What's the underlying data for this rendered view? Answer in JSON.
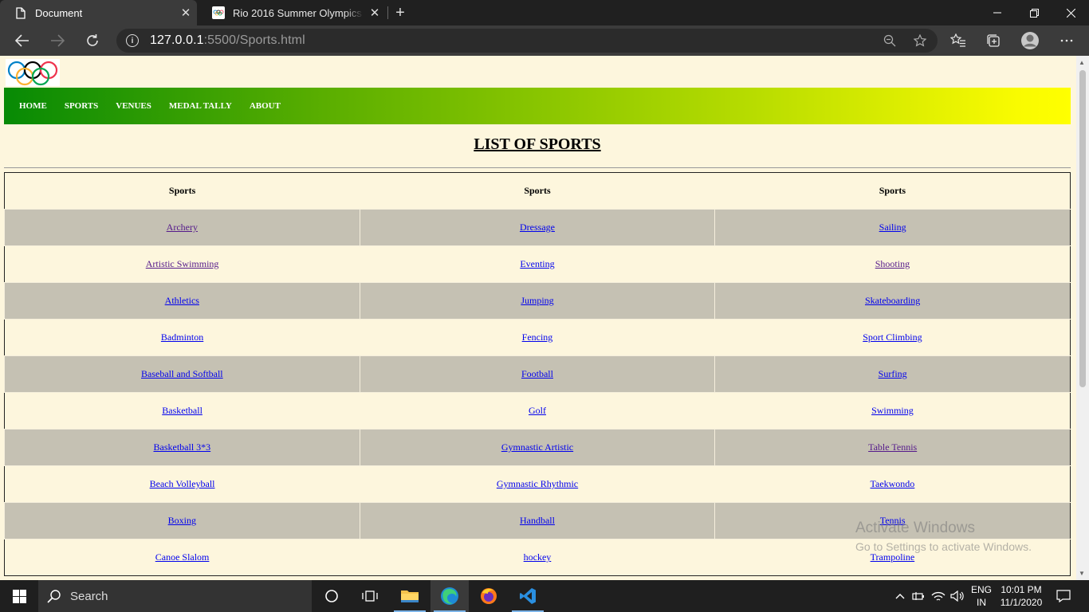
{
  "browser": {
    "tabs": [
      {
        "title": "Document",
        "active": true
      },
      {
        "title": "Rio 2016 Summer Olympics - res",
        "active": false
      }
    ],
    "url_host": "127.0.0.1",
    "url_rest": ":5500/Sports.html"
  },
  "site": {
    "nav": [
      "HOME",
      "SPORTS",
      "VENUES",
      "MEDAL TALLY",
      "ABOUT"
    ],
    "title": "LIST OF SPORTS",
    "table": {
      "headers": [
        "Sports",
        "Sports",
        "Sports"
      ],
      "rows": [
        [
          "Archery",
          "Dressage",
          "Sailing"
        ],
        [
          "Artistic Swimming",
          "Eventing",
          "Shooting"
        ],
        [
          "Athletics",
          "Jumping",
          "Skateboarding"
        ],
        [
          "Badminton",
          "Fencing",
          "Sport Climbing"
        ],
        [
          "Baseball and Softball",
          "Football",
          "Surfing"
        ],
        [
          "Basketball",
          "Golf",
          "Swimming"
        ],
        [
          "Basketball 3*3",
          "Gymnastic Artistic",
          "Table Tennis"
        ],
        [
          "Beach Volleyball",
          "Gymnastic Rhythmic",
          "Taekwondo"
        ],
        [
          "Boxing",
          "Handball",
          "Tennis"
        ],
        [
          "Canoe Slalom",
          "hockey",
          "Trampoline"
        ]
      ]
    }
  },
  "watermark": {
    "title": "Activate Windows",
    "subtitle": "Go to Settings to activate Windows."
  },
  "taskbar": {
    "search_placeholder": "Search",
    "lang_1": "ENG",
    "lang_2": "IN",
    "time": "10:01 PM",
    "date": "11/1/2020"
  }
}
